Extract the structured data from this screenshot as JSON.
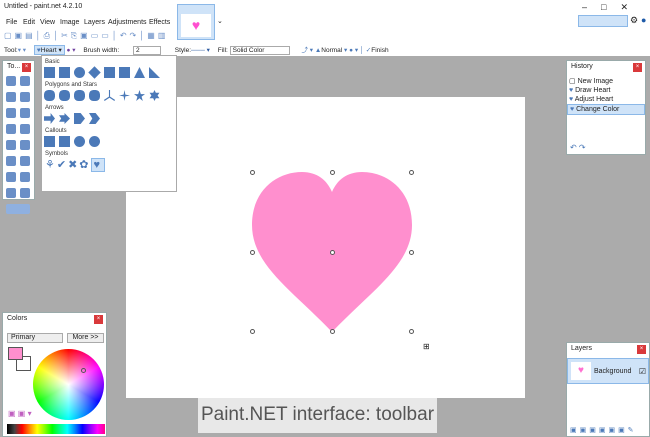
{
  "window": {
    "title": "Untitled - paint.net 4.2.10"
  },
  "menu": [
    "File",
    "Edit",
    "View",
    "Image",
    "Layers",
    "Adjustments",
    "Effects"
  ],
  "tool_options": {
    "tool_label": "Tool:",
    "shape": "Heart",
    "brush_width_label": "Brush width:",
    "brush_width": "2",
    "style_label": "Style:",
    "fill_label": "Fill:",
    "fill": "Solid Color",
    "blend": "Normal",
    "finish": "Finish"
  },
  "shapes_menu": {
    "sections": [
      {
        "title": "Basic",
        "count": 8
      },
      {
        "title": "Polygons and Stars",
        "count": 8
      },
      {
        "title": "Arrows",
        "count": 4
      },
      {
        "title": "Callouts",
        "count": 4
      },
      {
        "title": "Symbols",
        "count": 5
      }
    ]
  },
  "tools_panel": {
    "title": "To..."
  },
  "history": {
    "title": "History",
    "items": [
      "New Image",
      "Draw Heart",
      "Adjust Heart",
      "Change Color"
    ],
    "selected": "Change Color"
  },
  "colors": {
    "title": "Colors",
    "mode": "Primary",
    "more": "More >>",
    "primary": "#ff8fce",
    "secondary": "#ffffff"
  },
  "layers": {
    "title": "Layers",
    "items": [
      "Background"
    ]
  },
  "canvas": {
    "heart_color": "#ff8fce"
  },
  "caption": "Paint.NET interface: toolbar"
}
